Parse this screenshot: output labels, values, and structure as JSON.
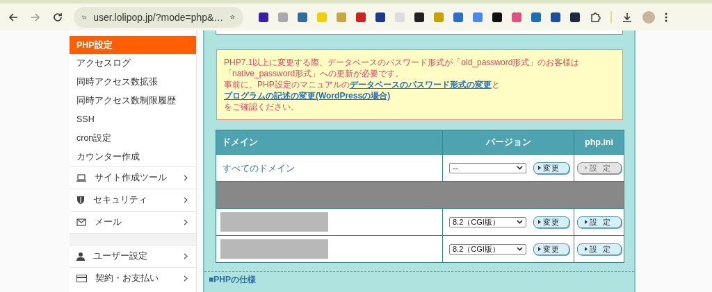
{
  "browser": {
    "url": "user.lolipop.jp/?mode=php&…"
  },
  "sidebar": {
    "items": [
      {
        "label": "PHP設定",
        "selected": true
      },
      {
        "label": "アクセスログ",
        "selected": false
      },
      {
        "label": "同時アクセス数拡張",
        "selected": false
      },
      {
        "label": "同時アクセス数制限履歴",
        "selected": false
      },
      {
        "label": "SSH",
        "selected": false
      },
      {
        "label": "cron設定",
        "selected": false
      },
      {
        "label": "カウンター作成",
        "selected": false
      }
    ],
    "sections": [
      {
        "kind": "laptop",
        "label": "サイト作成ツール"
      },
      {
        "kind": "shield",
        "label": "セキュリティ"
      },
      {
        "kind": "mail",
        "label": "メール"
      },
      {
        "kind": "gap"
      },
      {
        "kind": "user",
        "label": "ユーザー設定"
      },
      {
        "kind": "card",
        "label": "契約・お支払い"
      }
    ]
  },
  "notice": {
    "line1": "PHP7.1以上に変更する際、データベースのパスワード形式が「old_password形式」のお客様は「native_password形式」への更新が必要です。",
    "before": "事前に、PHP設定のマニュアルの",
    "link1": "データベースのパスワード形式の変更",
    "middle": "と",
    "link2": "プログラムの記述の変更(WordPressの場合)",
    "after": "をご確認ください。"
  },
  "table": {
    "columns": [
      "ドメイン",
      "バージョン",
      "php.ini"
    ],
    "rows": [
      {
        "kind": "all",
        "domain": "すべてのドメイン",
        "version": "--",
        "change": "変更",
        "settings": "設定",
        "disabled": true
      },
      {
        "kind": "redacted"
      },
      {
        "kind": "domain",
        "version": "8.2（CGI版）",
        "change": "変更",
        "settings": "設定",
        "disabled": false
      },
      {
        "kind": "domain",
        "version": "8.2（CGI版）",
        "change": "変更",
        "settings": "設定",
        "disabled": false
      }
    ]
  },
  "section_heading": "■PHPの仕様"
}
